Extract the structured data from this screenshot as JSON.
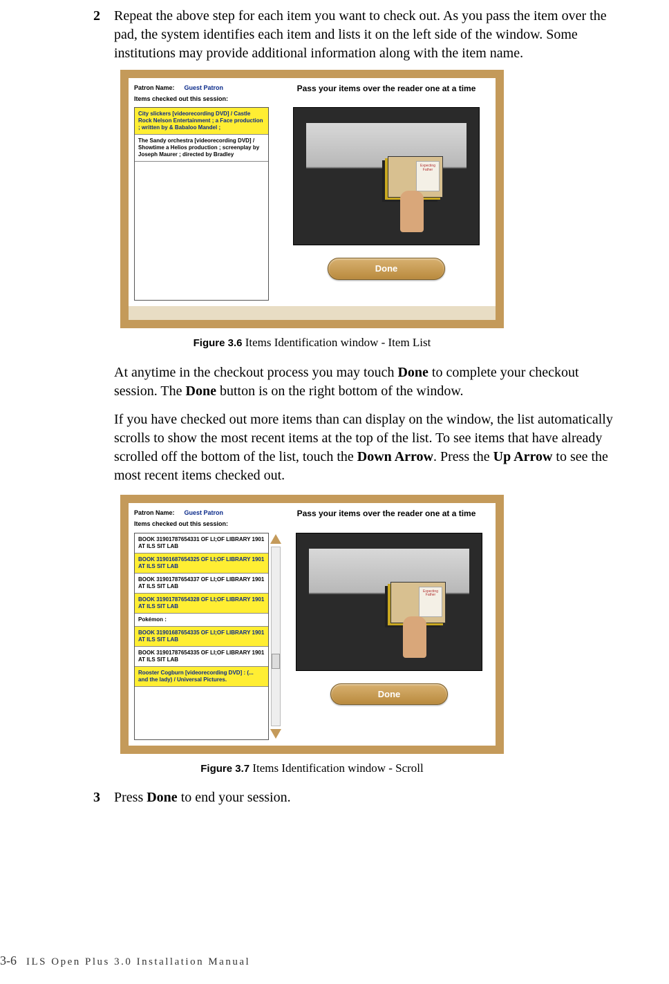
{
  "step2": {
    "num": "2",
    "text": "Repeat the above step for each item you want to check out. As you pass the item over the pad, the system identifies each item and lists it on the left side of the window. Some institutions may provide additional information along with the item name."
  },
  "fig36": {
    "label": "Figure 3.6",
    "caption": " Items Identification window - Item List",
    "patron_label": "Patron Name:",
    "patron_name": "Guest Patron",
    "session_label": "Items checked out this session:",
    "instruction": "Pass your items over the reader one at a time",
    "items": [
      {
        "text": "City slickers [videorecording DVD] / Castle Rock Nelson Entertainment ; a Face production ; written by & Babaloo Mandel ;",
        "hl": true
      },
      {
        "text": "The Sandy orchestra [videorecording DVD] / Showtime a Helios production ; screenplay by Joseph Maurer ; directed by Bradley",
        "hl": false
      }
    ],
    "done": "Done"
  },
  "para_done": {
    "p1a": "At anytime in the checkout process you may touch ",
    "p1b": "Done",
    "p1c": " to complete your checkout session. The ",
    "p1d": "Done",
    "p1e": " button is on the right bottom of the window."
  },
  "para_scroll": {
    "p2a": "If you have checked out more items than can display on the window, the list automatically scrolls to show the most recent items at the top of the list. To see items that have already scrolled off the bottom of the list, touch the ",
    "p2b": "Down Arrow",
    "p2c": ". Press the ",
    "p2d": "Up Arrow",
    "p2e": " to see the most recent items checked out."
  },
  "fig37": {
    "label": "Figure 3.7",
    "caption": " Items Identification window - Scroll",
    "patron_label": "Patron Name:",
    "patron_name": "Guest Patron",
    "session_label": "Items checked out this session:",
    "instruction": "Pass your items over the reader one at a time",
    "items": [
      {
        "text": "BOOK 31901787654331 OF LI;OF LIBRARY 1901 AT ILS SIT LAB",
        "hl": false
      },
      {
        "text": "BOOK 31901687654325 OF LI;OF LIBRARY 1901 AT ILS SIT LAB",
        "hl": true
      },
      {
        "text": "BOOK 31901787654337 OF LI;OF LIBRARY 1901 AT ILS SIT LAB",
        "hl": false
      },
      {
        "text": "BOOK 31901787654328 OF LI;OF LIBRARY 1901 AT ILS SIT LAB",
        "hl": true
      },
      {
        "text": "Pokémon :",
        "hl": false
      },
      {
        "text": "BOOK 31901687654335 OF LI;OF LIBRARY 1901 AT ILS SIT LAB",
        "hl": true
      },
      {
        "text": "BOOK 31901787654335 OF LI;OF LIBRARY 1901 AT ILS SIT LAB",
        "hl": false
      },
      {
        "text": "Rooster Cogburn [videorecording DVD] : (... and the lady) / Universal Pictures.",
        "hl": true
      }
    ],
    "done": "Done"
  },
  "step3": {
    "num": "3",
    "a": "Press ",
    "b": "Done",
    "c": " to end your session."
  },
  "footer": {
    "page": "3-6",
    "title": "ILS Open Plus 3.0 Installation Manual"
  }
}
